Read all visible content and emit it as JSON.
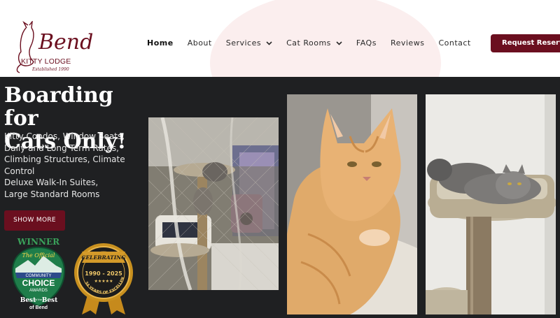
{
  "brand": {
    "logo_script": "Bend",
    "logo_name": "KITTY LODGE",
    "logo_established": "Established 1990"
  },
  "nav": {
    "items": [
      {
        "label": "Home",
        "active": true,
        "has_dropdown": false
      },
      {
        "label": "About",
        "active": false,
        "has_dropdown": false
      },
      {
        "label": "Services",
        "active": false,
        "has_dropdown": true
      },
      {
        "label": "Cat Rooms",
        "active": false,
        "has_dropdown": true
      },
      {
        "label": "FAQs",
        "active": false,
        "has_dropdown": false
      },
      {
        "label": "Reviews",
        "active": false,
        "has_dropdown": false
      },
      {
        "label": "Contact",
        "active": false,
        "has_dropdown": false
      }
    ],
    "cta_label": "Request Reservation"
  },
  "hero": {
    "title_line1": "Boarding for",
    "title_line2": "Cats Only!",
    "desc_line1": "Kitty Condos, Window Seats,",
    "desc_line2": "Daily and Long Term Rates,",
    "desc_line3": "Climbing Structures, Climate",
    "desc_line4": "Control",
    "desc_line5": "Deluxe Walk-In Suites,",
    "desc_line6": "Large Standard Rooms",
    "button_label": "SHOW MORE"
  },
  "badges": {
    "winner": {
      "top": "WINNER",
      "line1": "The Official",
      "line2": "COMMUNITY",
      "line3": "CHOICE",
      "line4": "AWARDS",
      "line5": "Best",
      "line6": "of the",
      "line7": "Best",
      "line8": "of Bend"
    },
    "celebrating": {
      "ribbon": "CELEBRATING",
      "years": "1990 - 2025",
      "stars": "★★★★★",
      "arc": "34 YEARS OF EXCELLENCE"
    }
  },
  "colors": {
    "brand": "#6b0f1f",
    "hero_bg": "#1f2022",
    "header_bg": "#ffffff",
    "blob": "#fbeeee"
  }
}
